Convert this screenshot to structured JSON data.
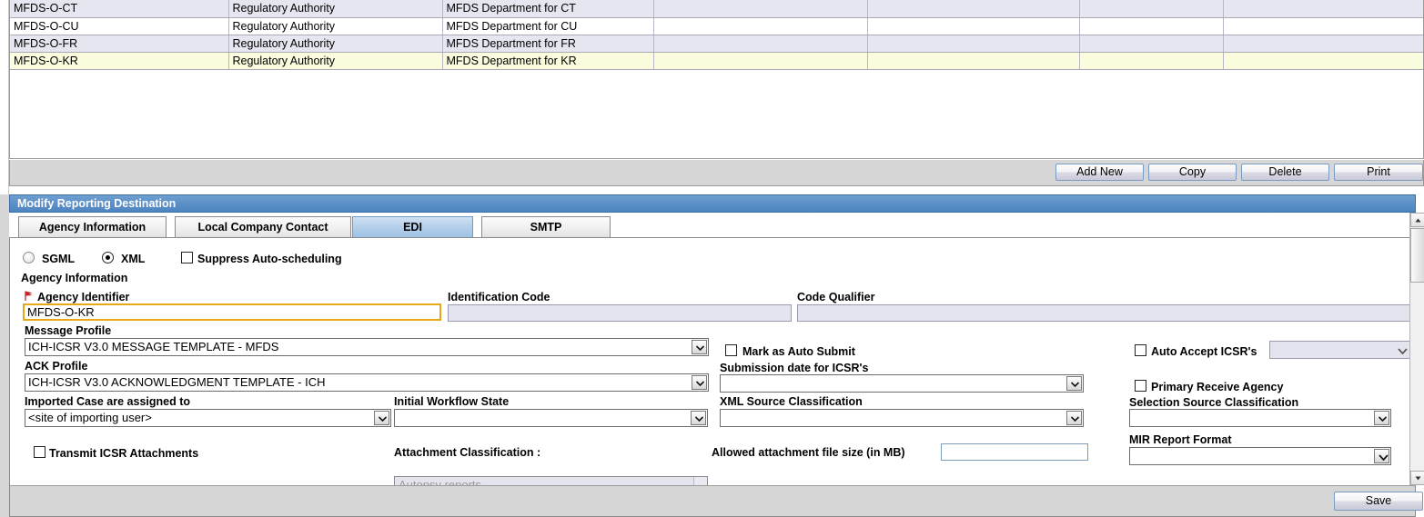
{
  "grid": {
    "columns": [
      "destination",
      "type",
      "department",
      "col4",
      "col5",
      "col6",
      "col7"
    ],
    "rows": [
      {
        "destination": "MFDS-O-CT",
        "type": "Regulatory Authority",
        "department": "MFDS Department for CT",
        "col4": "",
        "col5": "",
        "col6": "",
        "col7": "",
        "style": "alt"
      },
      {
        "destination": "MFDS-O-CU",
        "type": "Regulatory Authority",
        "department": "MFDS Department for CU",
        "col4": "",
        "col5": "",
        "col6": "",
        "col7": "",
        "style": "plain"
      },
      {
        "destination": "MFDS-O-FR",
        "type": "Regulatory Authority",
        "department": "MFDS Department for FR",
        "col4": "",
        "col5": "",
        "col6": "",
        "col7": "",
        "style": "alt"
      },
      {
        "destination": "MFDS-O-KR",
        "type": "Regulatory Authority",
        "department": "MFDS Department for KR",
        "col4": "",
        "col5": "",
        "col6": "",
        "col7": "",
        "style": "selected"
      }
    ]
  },
  "grid_buttons": {
    "add_new": "Add New",
    "copy": "Copy",
    "delete": "Delete",
    "print": "Print"
  },
  "section": {
    "title": "Modify Reporting Destination"
  },
  "tabs": [
    {
      "label": "Agency Information",
      "active": false
    },
    {
      "label": "Local Company Contact",
      "active": false
    },
    {
      "label": "EDI",
      "active": true
    },
    {
      "label": "SMTP",
      "active": false
    }
  ],
  "form": {
    "format_sgml_label": "SGML",
    "format_xml_label": "XML",
    "format_selected": "XML",
    "suppress_auto_scheduling_label": "Suppress Auto-scheduling",
    "suppress_auto_scheduling_checked": false,
    "agency_information_heading": "Agency Information",
    "agency_identifier_label": "Agency Identifier",
    "agency_identifier_value": "MFDS-O-KR",
    "identification_code_label": "Identification Code",
    "identification_code_value": "",
    "code_qualifier_label": "Code Qualifier",
    "code_qualifier_value": "",
    "message_profile_label": "Message Profile",
    "message_profile_value": "ICH-ICSR V3.0 MESSAGE TEMPLATE - MFDS",
    "ack_profile_label": "ACK Profile",
    "ack_profile_value": "ICH-ICSR V3.0 ACKNOWLEDGMENT TEMPLATE - ICH",
    "mark_as_auto_submit_label": "Mark as Auto Submit",
    "mark_as_auto_submit_checked": false,
    "submission_date_label": "Submission date for ICSR's",
    "submission_date_value": "",
    "auto_accept_icsrs_label": "Auto Accept ICSR's",
    "auto_accept_icsrs_checked": false,
    "auto_accept_icsrs_value": "",
    "primary_receive_agency_label": "Primary Receive Agency",
    "primary_receive_agency_checked": false,
    "selection_source_classification_label": "Selection Source Classification",
    "selection_source_classification_value": "",
    "imported_case_label": "Imported Case are assigned to",
    "imported_case_value": "<site of importing user>",
    "initial_workflow_state_label": "Initial Workflow State",
    "initial_workflow_state_value": "",
    "xml_source_classification_label": "XML Source Classification",
    "xml_source_classification_value": "",
    "transmit_icsr_attachments_label": "Transmit ICSR Attachments",
    "transmit_icsr_attachments_checked": false,
    "attachment_classification_label": "Attachment Classification :",
    "attachment_classification_first_item": "Autopsy reports",
    "allowed_attachment_size_label": "Allowed attachment file size (in MB)",
    "allowed_attachment_size_value": "",
    "mir_report_format_label": "MIR Report Format",
    "mir_report_format_value": ""
  },
  "footer": {
    "save_label": "Save"
  },
  "colors": {
    "section_bar": "#5c90c8",
    "active_tab": "#9ec3e6",
    "selected_row": "#fbfbdd",
    "alt_row": "#e6e6f0",
    "required_field_border": "#e6a817",
    "disabled_field_bg": "#e4e4ee"
  }
}
